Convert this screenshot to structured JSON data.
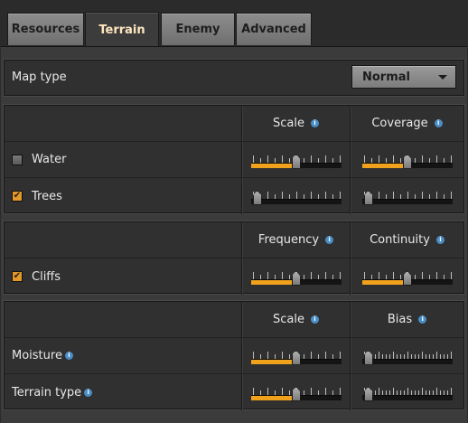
{
  "tabs": [
    {
      "label": "Resources",
      "active": false
    },
    {
      "label": "Terrain",
      "active": true
    },
    {
      "label": "Enemy",
      "active": false
    },
    {
      "label": "Advanced",
      "active": false
    }
  ],
  "map_type": {
    "label": "Map type",
    "value": "Normal"
  },
  "section1": {
    "headers": [
      "Scale",
      "Coverage"
    ],
    "rows": [
      {
        "label": "Water",
        "checked": false,
        "sliders": [
          0.5,
          0.5
        ]
      },
      {
        "label": "Trees",
        "checked": true,
        "sliders": [
          0.0,
          0.0
        ]
      }
    ]
  },
  "section2": {
    "headers": [
      "Frequency",
      "Continuity"
    ],
    "rows": [
      {
        "label": "Cliffs",
        "checked": true,
        "sliders": [
          0.5,
          0.5
        ]
      }
    ]
  },
  "section3": {
    "headers": [
      "Scale",
      "Bias"
    ],
    "rows": [
      {
        "label": "Moisture",
        "sliders": [
          0.5,
          0.0
        ]
      },
      {
        "label": "Terrain type",
        "sliders": [
          0.5,
          0.0
        ]
      }
    ]
  },
  "info_glyph": "i",
  "checkmark_glyph": "✔",
  "colors": {
    "accent": "#f0a21c",
    "info": "#4a8ec6",
    "active_tab_text": "#ffe6c0"
  }
}
